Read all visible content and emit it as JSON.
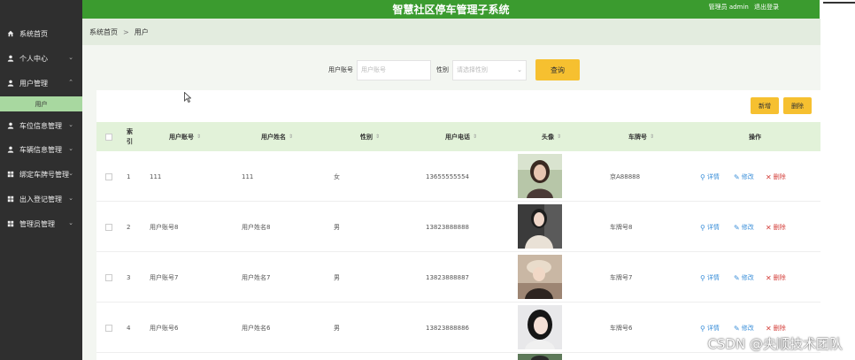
{
  "app": {
    "title": "智慧社区停车管理子系统",
    "user_label": "管理员 admin",
    "logout_label": "退出登录"
  },
  "sidebar": {
    "items": [
      {
        "label": "系统首页",
        "icon": "home-icon",
        "has_chevron": false
      },
      {
        "label": "个人中心",
        "icon": "user-icon",
        "has_chevron": true
      },
      {
        "label": "用户管理",
        "icon": "user-icon",
        "has_chevron": true,
        "expanded": true
      },
      {
        "label": "车位信息管理",
        "icon": "user-icon",
        "has_chevron": true
      },
      {
        "label": "车辆信息管理",
        "icon": "user-icon",
        "has_chevron": true
      },
      {
        "label": "绑定车牌号管理",
        "icon": "grid-icon",
        "has_chevron": true
      },
      {
        "label": "出入登记管理",
        "icon": "grid-icon",
        "has_chevron": true
      },
      {
        "label": "管理员管理",
        "icon": "grid-icon",
        "has_chevron": true
      }
    ],
    "submenu": {
      "label": "用户"
    }
  },
  "breadcrumb": {
    "home": "系统首页",
    "separator": ">",
    "current": "用户"
  },
  "search": {
    "account_label": "用户账号",
    "account_placeholder": "用户账号",
    "gender_label": "性别",
    "gender_placeholder": "请选择性别",
    "query_label": "查询"
  },
  "toolbar": {
    "add_label": "新增",
    "delete_label": "删除"
  },
  "table": {
    "headers": {
      "index": "索引",
      "account": "用户账号",
      "name": "用户姓名",
      "gender": "性别",
      "phone": "用户电话",
      "avatar": "头像",
      "plate": "车牌号",
      "actions": "操作"
    },
    "sort_glyph": "⇕",
    "rows": [
      {
        "index": "1",
        "account": "111",
        "name": "111",
        "gender": "女",
        "phone": "13655555554",
        "plate": "京A88888"
      },
      {
        "index": "2",
        "account": "用户账号8",
        "name": "用户姓名8",
        "gender": "男",
        "phone": "13823888888",
        "plate": "车牌号8"
      },
      {
        "index": "3",
        "account": "用户账号7",
        "name": "用户姓名7",
        "gender": "男",
        "phone": "13823888887",
        "plate": "车牌号7"
      },
      {
        "index": "4",
        "account": "用户账号6",
        "name": "用户姓名6",
        "gender": "男",
        "phone": "13823888886",
        "plate": "车牌号6"
      }
    ],
    "actions": {
      "detail": "详情",
      "edit": "修改",
      "delete": "删除"
    }
  },
  "watermark": "CSDN @央顺技术团队",
  "colors": {
    "sidebar_bg": "#2f2f2f",
    "topbar_bg": "#3b9b2f",
    "accent_yellow": "#f6c030",
    "header_row_bg": "#e2f2d9",
    "active_submenu": "#a8d8a0",
    "link_blue": "#3b8fd9",
    "danger_red": "#d43f3a"
  }
}
